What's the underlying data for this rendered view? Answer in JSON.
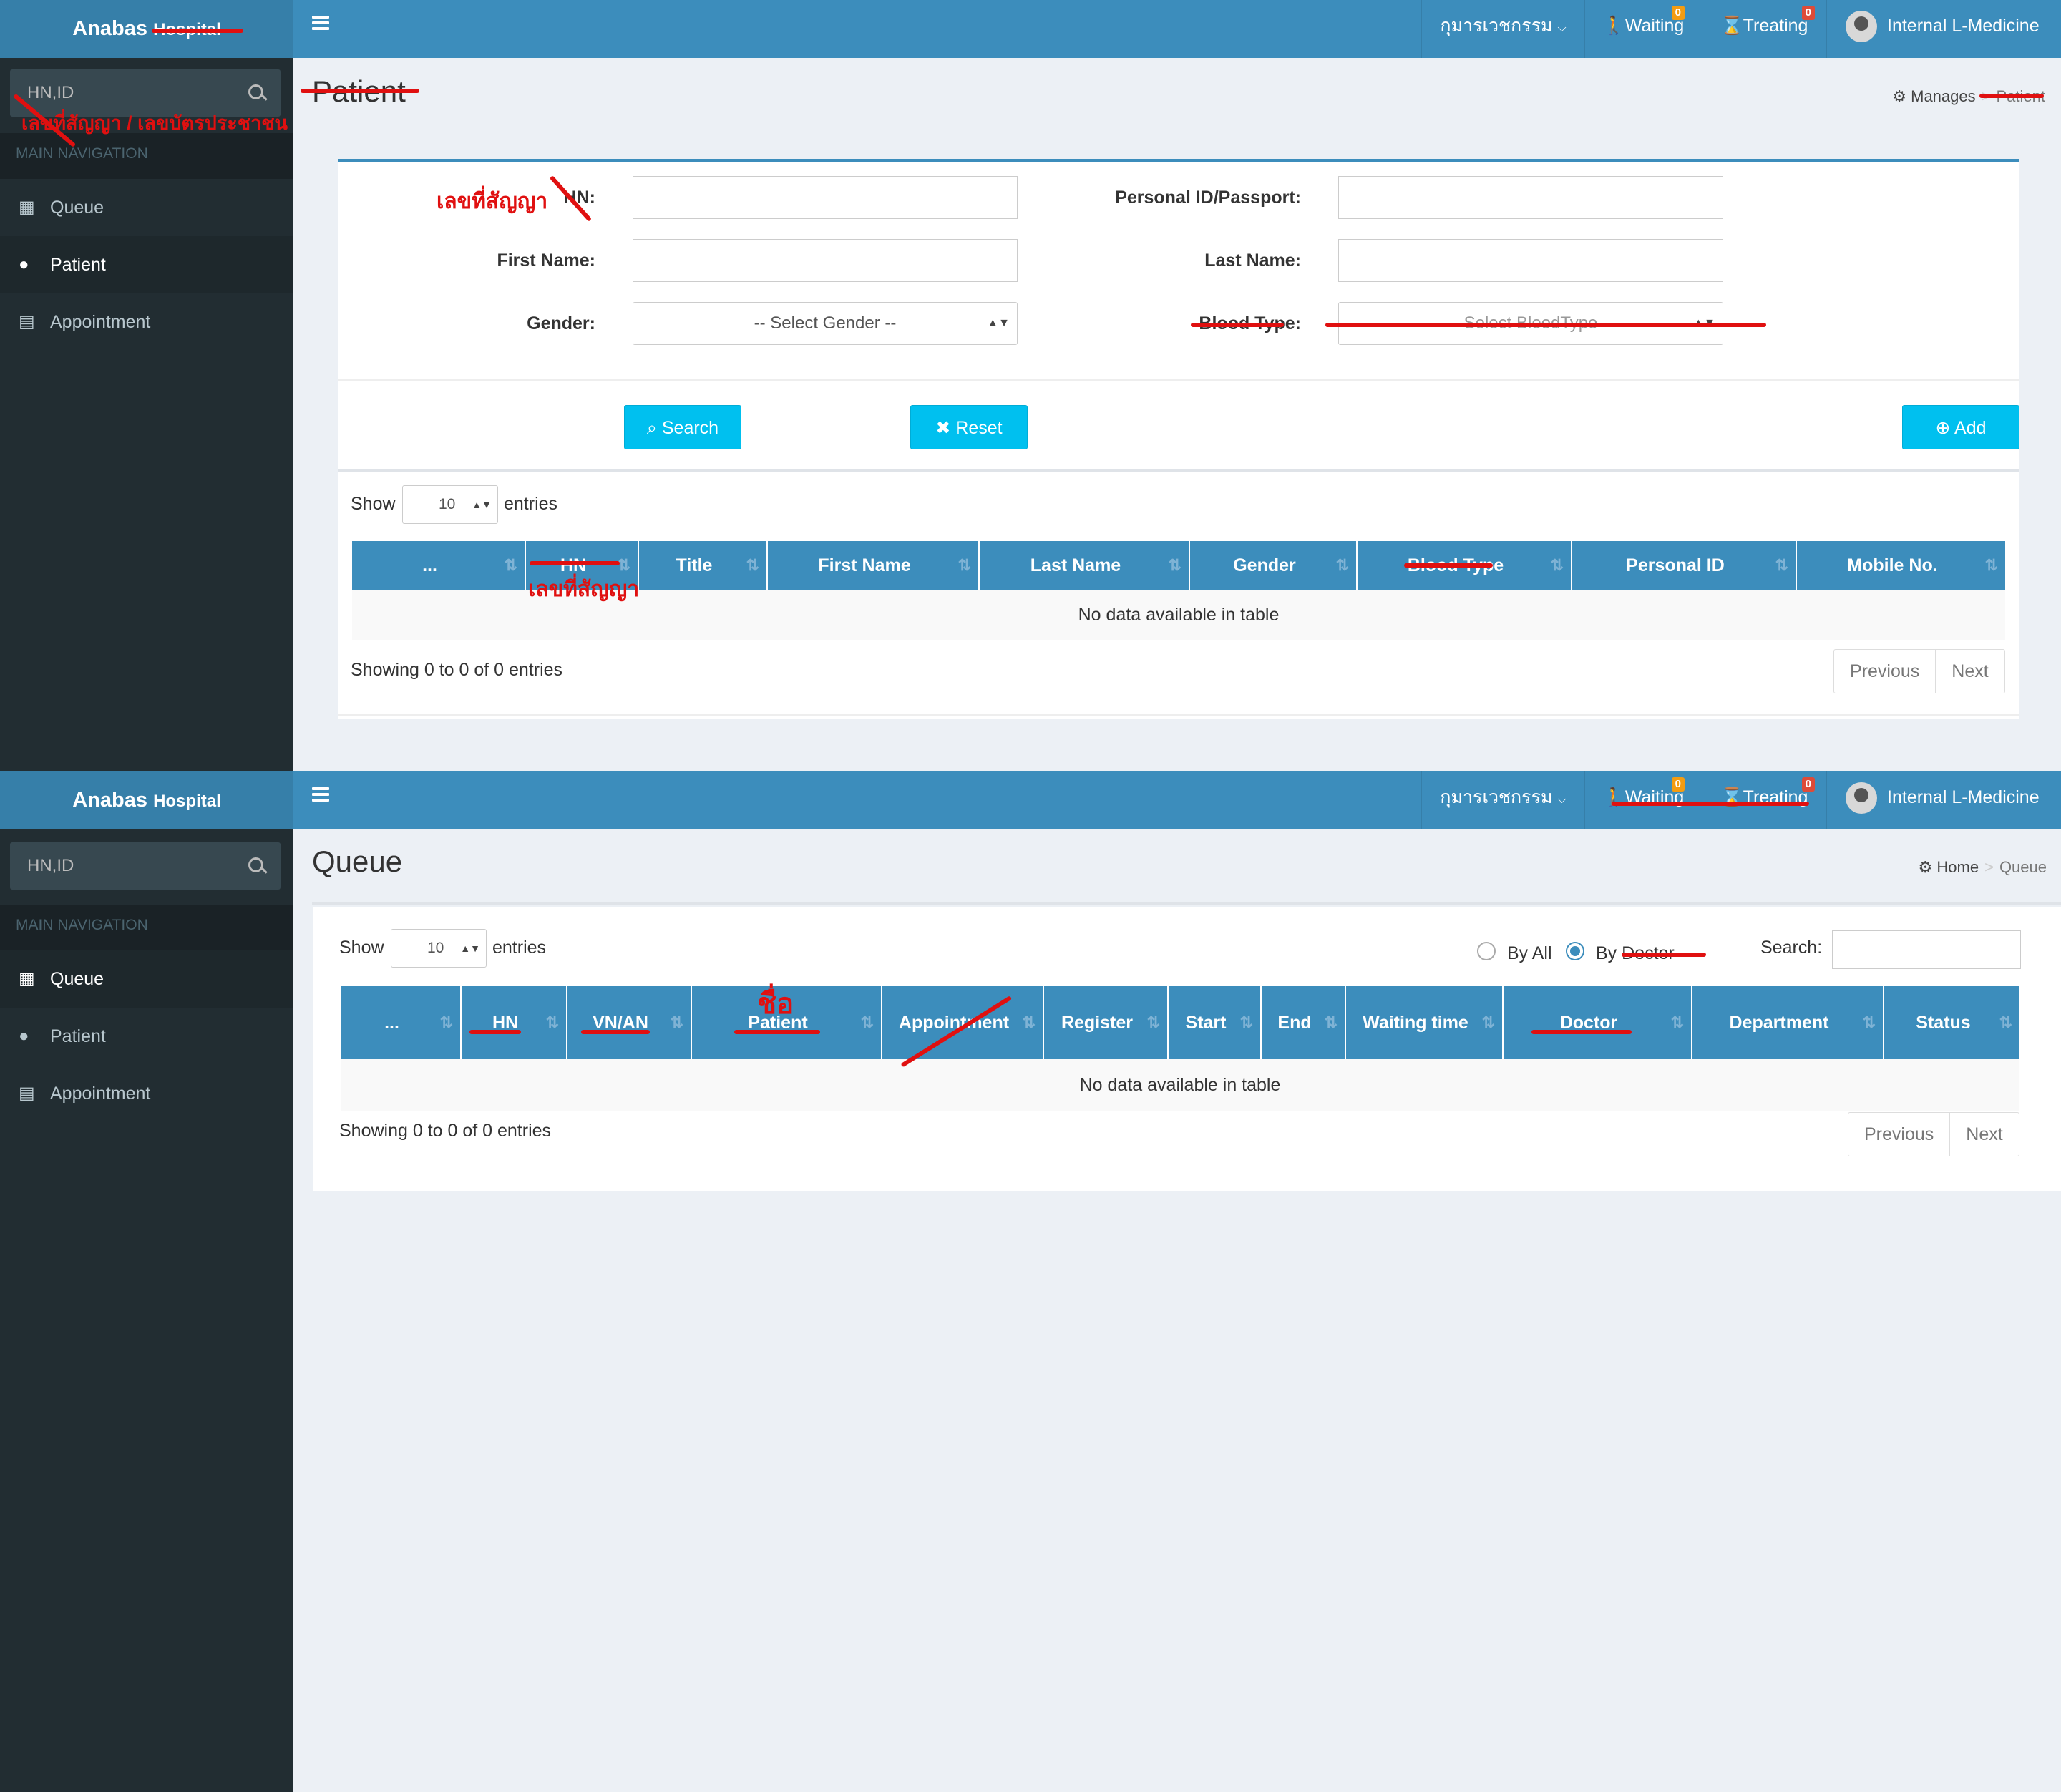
{
  "app": {
    "brand": "Anabas",
    "brand_suffix": "Hospital"
  },
  "sidebar": {
    "search_placeholder": "HN,ID",
    "nav_header": "MAIN NAVIGATION",
    "items": [
      {
        "label": "Queue",
        "icon": "grid-icon"
      },
      {
        "label": "Patient",
        "icon": "user-icon"
      },
      {
        "label": "Appointment",
        "icon": "calendar-icon"
      }
    ]
  },
  "topbar": {
    "department_menu": "กุมารเวชกรรม",
    "waiting_label": "Waiting",
    "waiting_count": "0",
    "treating_label": "Treating",
    "treating_count": "0",
    "user_name": "Internal L-Medicine"
  },
  "patient_screen": {
    "title": "Patient",
    "breadcrumb": [
      "Manages",
      "Patient"
    ],
    "form": {
      "hn_label": "HN:",
      "personal_id_label": "Personal ID/Passport:",
      "first_name_label": "First Name:",
      "last_name_label": "Last Name:",
      "gender_label": "Gender:",
      "gender_value": "-- Select Gender --",
      "blood_type_label": "Blood Type:",
      "blood_type_value": "-- Select BloodType --"
    },
    "buttons": {
      "search": "Search",
      "reset": "Reset",
      "add": "Add"
    },
    "length": {
      "show": "Show",
      "value": "10",
      "entries": "entries"
    },
    "columns": [
      "...",
      "HN",
      "Title",
      "First Name",
      "Last Name",
      "Gender",
      "Blood Type",
      "Personal ID",
      "Mobile No."
    ],
    "empty_text": "No data available in table",
    "info": "Showing 0 to 0 of 0 entries",
    "pager": {
      "previous": "Previous",
      "next": "Next"
    },
    "annotations": {
      "search_note": "เลขที่สัญญา / เลขบัตรประชาชน",
      "hn_note": "เลขที่สัญญา",
      "column_note": "เลขที่สัญญา"
    }
  },
  "queue_screen": {
    "title": "Queue",
    "breadcrumb": [
      "Home",
      "Queue"
    ],
    "length": {
      "show": "Show",
      "value": "10",
      "entries": "entries"
    },
    "filter": {
      "by_all": "By All",
      "by_doctor": "By Doctor",
      "search_label": "Search:"
    },
    "columns": [
      "...",
      "HN",
      "VN/AN",
      "Patient",
      "Appointment",
      "Register",
      "Start",
      "End",
      "Waiting time",
      "Doctor",
      "Department",
      "Status"
    ],
    "empty_text": "No data available in table",
    "info": "Showing 0 to 0 of 0 entries",
    "pager": {
      "previous": "Previous",
      "next": "Next"
    },
    "annotations": {
      "patient_note": "ชื่อ"
    }
  }
}
